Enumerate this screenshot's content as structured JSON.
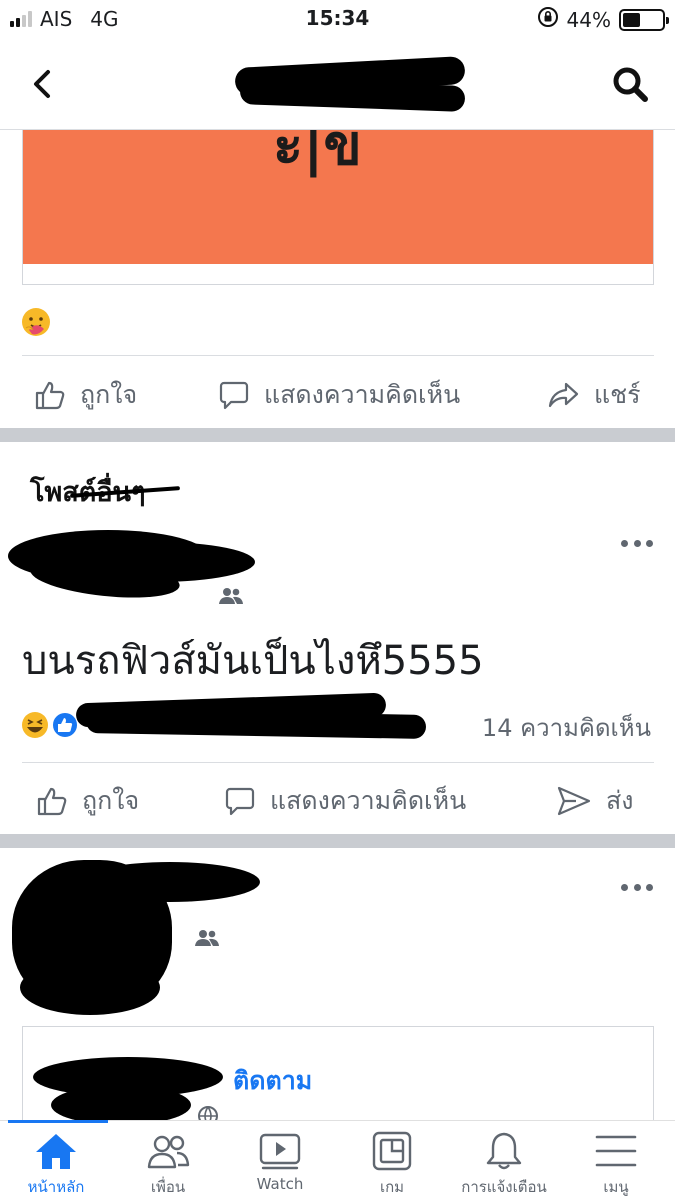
{
  "status_bar": {
    "carrier": "AIS",
    "network": "4G",
    "time": "15:34",
    "battery": "44%",
    "battery_level": 0.44
  },
  "post_one": {
    "actions": {
      "like": "ถูกใจ",
      "comment": "แสดงความคิดเห็น",
      "share": "แชร์"
    }
  },
  "section": {
    "title": "โพสต์อื่นๆ"
  },
  "post_two": {
    "text": "บนรถฟิวส์มันเป็นไงหึ5555",
    "comment_count": "14 ความคิดเห็น",
    "actions": {
      "like": "ถูกใจ",
      "comment": "แสดงความคิดเห็น",
      "send": "ส่ง"
    }
  },
  "post_three": {
    "follow": "ติดตาม"
  },
  "tabs": [
    {
      "label": "หน้าหลัก",
      "icon": "home-icon",
      "active": true
    },
    {
      "label": "เพื่อน",
      "icon": "friends-icon"
    },
    {
      "label": "Watch",
      "icon": "watch-icon"
    },
    {
      "label": "เกม",
      "icon": "gaming-icon"
    },
    {
      "label": "การแจ้งเตือน",
      "icon": "bell-icon"
    },
    {
      "label": "เมนู",
      "icon": "menu-icon"
    }
  ],
  "colors": {
    "accent": "#1877f2",
    "orange_banner": "#f4774e",
    "separator": "#c9ccd1",
    "muted_text": "#606770"
  }
}
